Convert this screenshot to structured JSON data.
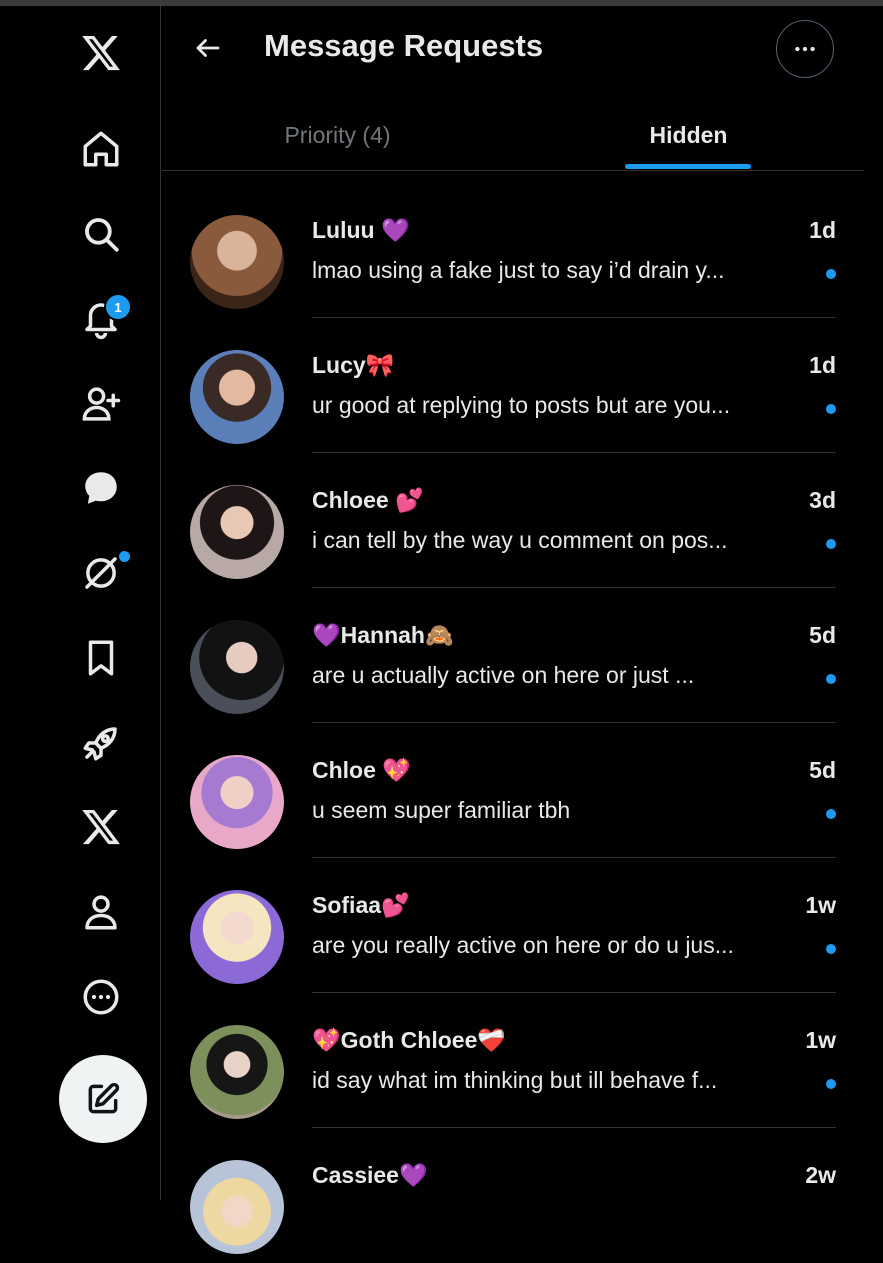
{
  "header": {
    "title": "Message Requests"
  },
  "tabs": [
    {
      "label": "Priority (4)",
      "active": false
    },
    {
      "label": "Hidden",
      "active": true
    }
  ],
  "nav": {
    "items": [
      "x-logo-icon",
      "home-icon",
      "search-icon",
      "notifications-icon",
      "follow-icon",
      "messages-icon",
      "grok-icon",
      "bookmarks-icon",
      "premium-icon",
      "x-premium-icon",
      "profile-icon",
      "more-icon"
    ],
    "notification_count": "1",
    "compose_icon": "compose-icon"
  },
  "colors": {
    "accent": "#1d9bf0",
    "background": "#000000",
    "text": "#e7e9ea",
    "muted": "#71767b",
    "border": "#2f3336"
  },
  "messages": [
    {
      "name": "Luluu 💜",
      "time": "1d",
      "preview": "lmao using a fake just to say i’d drain y...",
      "unread": true
    },
    {
      "name": "Lucy🎀",
      "time": "1d",
      "preview": "ur good at replying to posts but are you...",
      "unread": true
    },
    {
      "name": "Chloee 💕",
      "time": "3d",
      "preview": "i can tell by the way u comment on pos...",
      "unread": true
    },
    {
      "name": "💜Hannah🙈",
      "time": "5d",
      "preview": "are u actually active on here or just ...",
      "unread": true
    },
    {
      "name": "Chloe 💖",
      "time": "5d",
      "preview": "u seem super familiar tbh",
      "unread": true
    },
    {
      "name": "Sofiaa💕",
      "time": "1w",
      "preview": "are you really active on here or do u jus...",
      "unread": true
    },
    {
      "name": "💖Goth Chloee❤️‍🩹",
      "time": "1w",
      "preview": "id say what im thinking but ill behave f...",
      "unread": true
    },
    {
      "name": "Cassiee💜",
      "time": "2w",
      "preview": "",
      "unread": false
    }
  ]
}
